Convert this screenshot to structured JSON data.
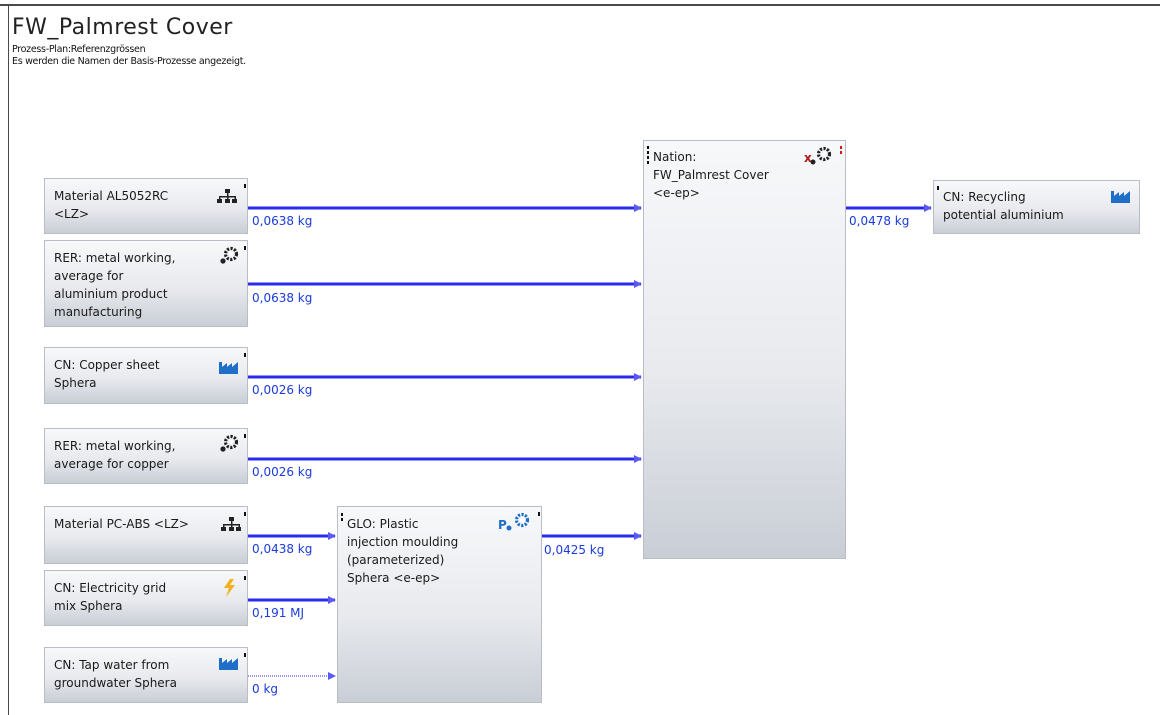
{
  "header": {
    "title": "FW_Palmrest Cover",
    "subtitle1": "Prozess-Plan:Referenzgrössen",
    "subtitle2": "Es werden die Namen der Basis-Prozesse angezeigt."
  },
  "colors": {
    "flow": "#2b2bf0",
    "flow_text": "#1a3bdc",
    "icon_blue": "#1f6fc8",
    "icon_yellow": "#f2b01e",
    "icon_red": "#b01818"
  },
  "nodes": {
    "material_al": {
      "label": "Material AL5052RC\n<LZ>",
      "icon": "plan-hierarchy-icon"
    },
    "metal_al": {
      "label": "RER: metal working,\naverage for\naluminium product\nmanufacturing",
      "icon": "gears-icon"
    },
    "copper_sheet": {
      "label": "CN: Copper sheet\nSphera",
      "icon": "factory-icon"
    },
    "metal_cu": {
      "label": "RER: metal working,\naverage for copper",
      "icon": "gears-icon"
    },
    "material_pcabs": {
      "label": "Material PC-ABS <LZ>",
      "icon": "plan-hierarchy-icon"
    },
    "electricity": {
      "label": "CN: Electricity grid\nmix Sphera",
      "icon": "lightning-icon"
    },
    "tap_water": {
      "label": "CN: Tap water from\ngroundwater Sphera",
      "icon": "factory-icon"
    },
    "moulding": {
      "label": "GLO: Plastic\ninjection moulding\n(parameterized)\nSphera <e-ep>",
      "icon": "parameterized-gears-icon"
    },
    "nation": {
      "label": "Nation:\nFW_Palmrest Cover\n<e-ep>",
      "icon": "excluded-gears-icon"
    },
    "recycling": {
      "label": "CN: Recycling\npotential aluminium",
      "icon": "factory-icon"
    }
  },
  "flows": {
    "f1": "0,0638 kg",
    "f2": "0,0638 kg",
    "f3": "0,0026 kg",
    "f4": "0,0026 kg",
    "f5": "0,0438 kg",
    "f6": "0,191 MJ",
    "f7": "0 kg",
    "f8": "0,0425 kg",
    "f9": "0,0478 kg"
  }
}
